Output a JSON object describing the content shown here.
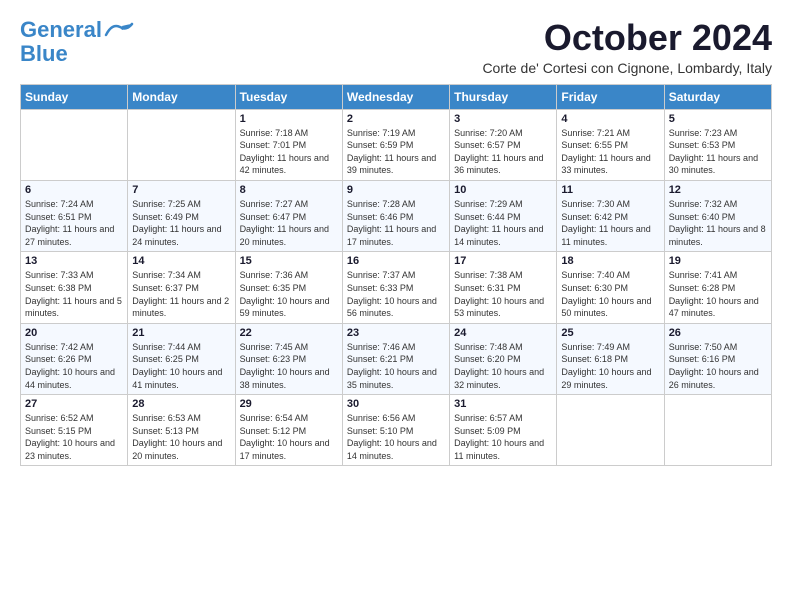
{
  "logo": {
    "part1": "General",
    "part2": "Blue"
  },
  "title": "October 2024",
  "location": "Corte de' Cortesi con Cignone, Lombardy, Italy",
  "days_of_week": [
    "Sunday",
    "Monday",
    "Tuesday",
    "Wednesday",
    "Thursday",
    "Friday",
    "Saturday"
  ],
  "weeks": [
    [
      {
        "day": "",
        "info": ""
      },
      {
        "day": "",
        "info": ""
      },
      {
        "day": "1",
        "info": "Sunrise: 7:18 AM\nSunset: 7:01 PM\nDaylight: 11 hours and 42 minutes."
      },
      {
        "day": "2",
        "info": "Sunrise: 7:19 AM\nSunset: 6:59 PM\nDaylight: 11 hours and 39 minutes."
      },
      {
        "day": "3",
        "info": "Sunrise: 7:20 AM\nSunset: 6:57 PM\nDaylight: 11 hours and 36 minutes."
      },
      {
        "day": "4",
        "info": "Sunrise: 7:21 AM\nSunset: 6:55 PM\nDaylight: 11 hours and 33 minutes."
      },
      {
        "day": "5",
        "info": "Sunrise: 7:23 AM\nSunset: 6:53 PM\nDaylight: 11 hours and 30 minutes."
      }
    ],
    [
      {
        "day": "6",
        "info": "Sunrise: 7:24 AM\nSunset: 6:51 PM\nDaylight: 11 hours and 27 minutes."
      },
      {
        "day": "7",
        "info": "Sunrise: 7:25 AM\nSunset: 6:49 PM\nDaylight: 11 hours and 24 minutes."
      },
      {
        "day": "8",
        "info": "Sunrise: 7:27 AM\nSunset: 6:47 PM\nDaylight: 11 hours and 20 minutes."
      },
      {
        "day": "9",
        "info": "Sunrise: 7:28 AM\nSunset: 6:46 PM\nDaylight: 11 hours and 17 minutes."
      },
      {
        "day": "10",
        "info": "Sunrise: 7:29 AM\nSunset: 6:44 PM\nDaylight: 11 hours and 14 minutes."
      },
      {
        "day": "11",
        "info": "Sunrise: 7:30 AM\nSunset: 6:42 PM\nDaylight: 11 hours and 11 minutes."
      },
      {
        "day": "12",
        "info": "Sunrise: 7:32 AM\nSunset: 6:40 PM\nDaylight: 11 hours and 8 minutes."
      }
    ],
    [
      {
        "day": "13",
        "info": "Sunrise: 7:33 AM\nSunset: 6:38 PM\nDaylight: 11 hours and 5 minutes."
      },
      {
        "day": "14",
        "info": "Sunrise: 7:34 AM\nSunset: 6:37 PM\nDaylight: 11 hours and 2 minutes."
      },
      {
        "day": "15",
        "info": "Sunrise: 7:36 AM\nSunset: 6:35 PM\nDaylight: 10 hours and 59 minutes."
      },
      {
        "day": "16",
        "info": "Sunrise: 7:37 AM\nSunset: 6:33 PM\nDaylight: 10 hours and 56 minutes."
      },
      {
        "day": "17",
        "info": "Sunrise: 7:38 AM\nSunset: 6:31 PM\nDaylight: 10 hours and 53 minutes."
      },
      {
        "day": "18",
        "info": "Sunrise: 7:40 AM\nSunset: 6:30 PM\nDaylight: 10 hours and 50 minutes."
      },
      {
        "day": "19",
        "info": "Sunrise: 7:41 AM\nSunset: 6:28 PM\nDaylight: 10 hours and 47 minutes."
      }
    ],
    [
      {
        "day": "20",
        "info": "Sunrise: 7:42 AM\nSunset: 6:26 PM\nDaylight: 10 hours and 44 minutes."
      },
      {
        "day": "21",
        "info": "Sunrise: 7:44 AM\nSunset: 6:25 PM\nDaylight: 10 hours and 41 minutes."
      },
      {
        "day": "22",
        "info": "Sunrise: 7:45 AM\nSunset: 6:23 PM\nDaylight: 10 hours and 38 minutes."
      },
      {
        "day": "23",
        "info": "Sunrise: 7:46 AM\nSunset: 6:21 PM\nDaylight: 10 hours and 35 minutes."
      },
      {
        "day": "24",
        "info": "Sunrise: 7:48 AM\nSunset: 6:20 PM\nDaylight: 10 hours and 32 minutes."
      },
      {
        "day": "25",
        "info": "Sunrise: 7:49 AM\nSunset: 6:18 PM\nDaylight: 10 hours and 29 minutes."
      },
      {
        "day": "26",
        "info": "Sunrise: 7:50 AM\nSunset: 6:16 PM\nDaylight: 10 hours and 26 minutes."
      }
    ],
    [
      {
        "day": "27",
        "info": "Sunrise: 6:52 AM\nSunset: 5:15 PM\nDaylight: 10 hours and 23 minutes."
      },
      {
        "day": "28",
        "info": "Sunrise: 6:53 AM\nSunset: 5:13 PM\nDaylight: 10 hours and 20 minutes."
      },
      {
        "day": "29",
        "info": "Sunrise: 6:54 AM\nSunset: 5:12 PM\nDaylight: 10 hours and 17 minutes."
      },
      {
        "day": "30",
        "info": "Sunrise: 6:56 AM\nSunset: 5:10 PM\nDaylight: 10 hours and 14 minutes."
      },
      {
        "day": "31",
        "info": "Sunrise: 6:57 AM\nSunset: 5:09 PM\nDaylight: 10 hours and 11 minutes."
      },
      {
        "day": "",
        "info": ""
      },
      {
        "day": "",
        "info": ""
      }
    ]
  ]
}
